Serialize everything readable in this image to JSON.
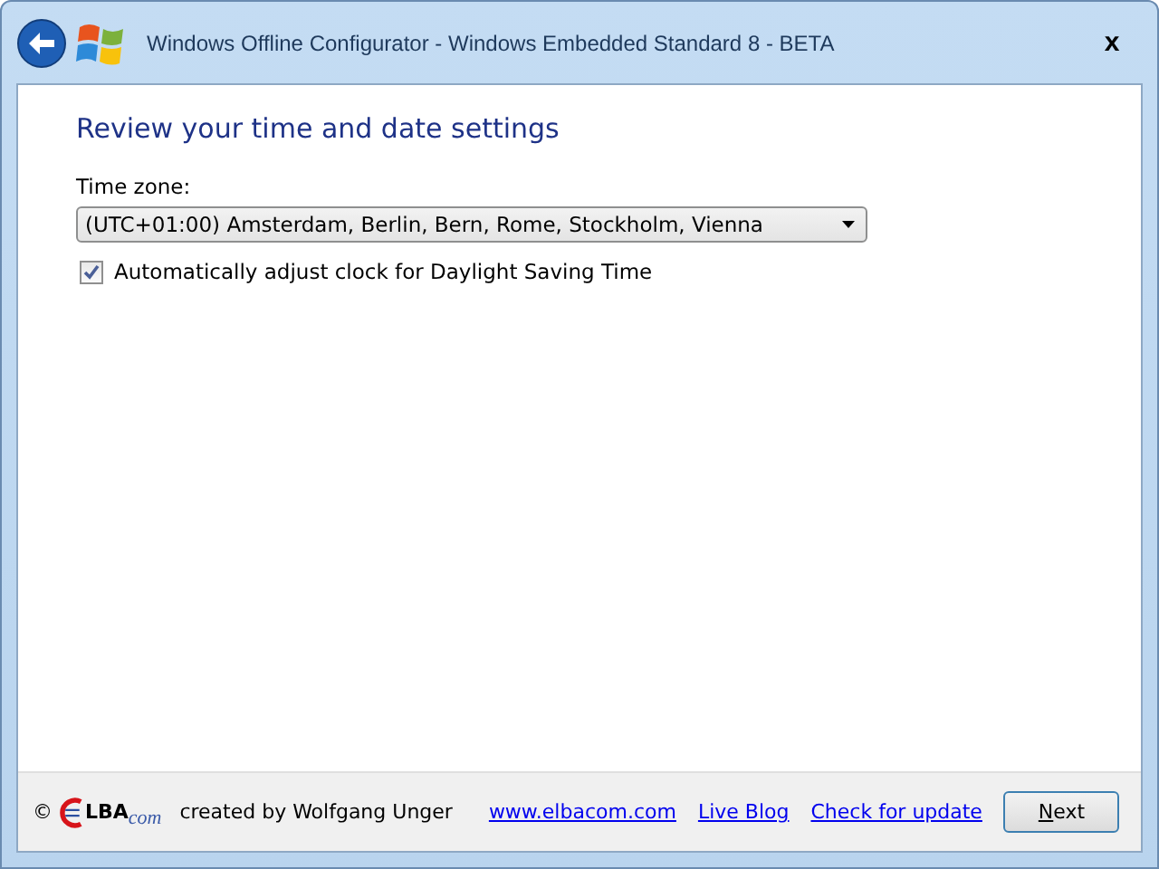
{
  "window": {
    "title": "Windows Offline Configurator - Windows Embedded Standard 8 - BETA",
    "close": "x"
  },
  "heading": "Review your time and date settings",
  "time_zone": {
    "label": "Time zone:",
    "value": "(UTC+01:00) Amsterdam, Berlin, Bern, Rome, Stockholm, Vienna"
  },
  "dst_checkbox": {
    "label": "Automatically adjust clock for Daylight Saving Time",
    "checked": true
  },
  "footer": {
    "copyright": "©",
    "logo": {
      "main": "LBA",
      "suffix": "com"
    },
    "credit": "created by Wolfgang Unger",
    "links": [
      "www.elbacom.com",
      "Live Blog",
      "Check for update"
    ],
    "next_button": "Next"
  }
}
